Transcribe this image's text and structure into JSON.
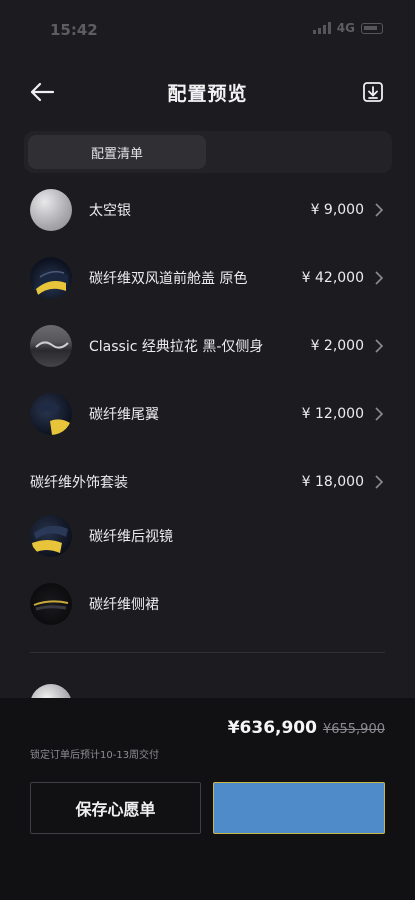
{
  "status_bar": {
    "time": "15:42",
    "network": "4G"
  },
  "header": {
    "title": "配置预览",
    "back_icon": "arrow-left-icon",
    "download_icon": "download-icon"
  },
  "tabs": [
    {
      "label": "配置清单",
      "active": true
    }
  ],
  "items": [
    {
      "label": "太空银",
      "price": "¥ 9,000",
      "thumb": "silver-swatch"
    },
    {
      "label": "碳纤维双风道前舱盖 原色",
      "price": "¥ 42,000",
      "thumb": "hood-thumbnail"
    },
    {
      "label": "Classic 经典拉花 黑-仅侧身",
      "price": "¥ 2,000",
      "thumb": "decal-thumbnail"
    },
    {
      "label": "碳纤维尾翼",
      "price": "¥ 12,000",
      "thumb": "wing-thumbnail"
    }
  ],
  "package": {
    "label": "碳纤维外饰套装",
    "price": "¥ 18,000",
    "sub_items": [
      {
        "label": "碳纤维后视镜",
        "thumb": "mirror-thumbnail"
      },
      {
        "label": "碳纤维侧裙",
        "thumb": "side-skirt-thumbnail"
      }
    ]
  },
  "footer": {
    "total_price": "¥636,900",
    "original_price": "¥655,900",
    "delivery_note": "锁定订单后预计10-13周交付",
    "save_button_label": "保存心愿单",
    "primary_button_label": ""
  },
  "colors": {
    "background": "#1c1c20",
    "footer_background": "#111113",
    "primary_button": "#4f8bc9",
    "primary_button_border": "#c9b64a"
  }
}
